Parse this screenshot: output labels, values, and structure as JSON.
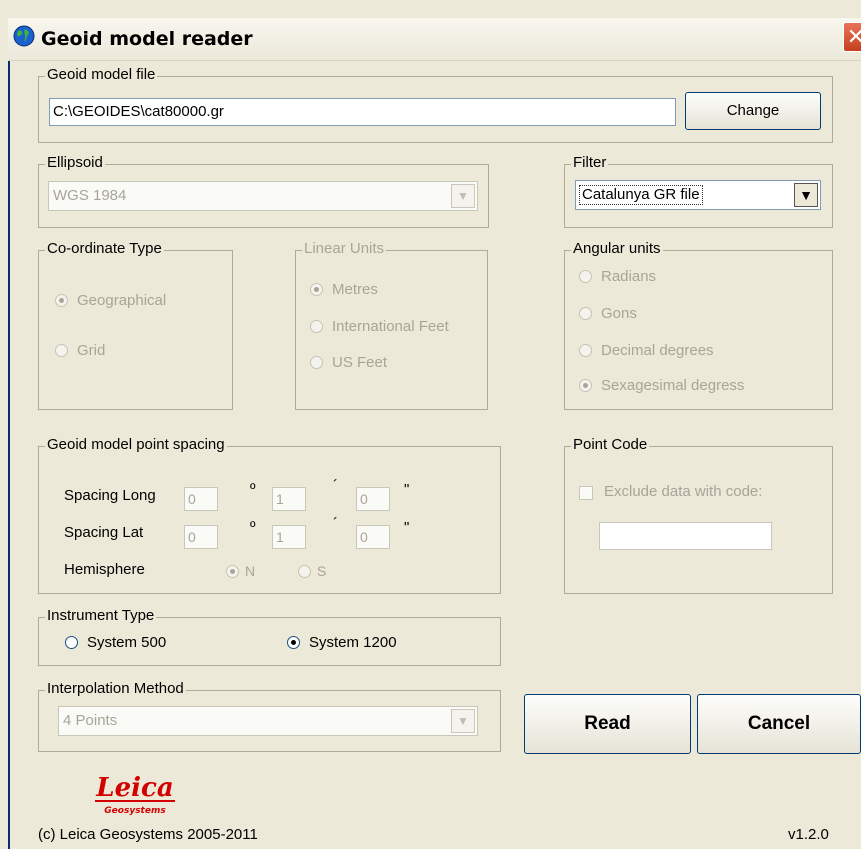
{
  "window": {
    "title": "Geoid model reader",
    "close_glyph": "✕",
    "icon": "globe-icon"
  },
  "model_file": {
    "legend": "Geoid model file",
    "path": "C:\\GEOIDES\\cat80000.gr",
    "change_label": "Change"
  },
  "ellipsoid": {
    "legend": "Ellipsoid",
    "value": "WGS 1984"
  },
  "filter": {
    "legend": "Filter",
    "value": "Catalunya GR file"
  },
  "coord_type": {
    "legend": "Co-ordinate Type",
    "options": [
      {
        "label": "Geographical",
        "selected": true
      },
      {
        "label": "Grid",
        "selected": false
      }
    ]
  },
  "linear_units": {
    "legend": "Linear Units",
    "options": [
      {
        "label": "Metres",
        "selected": true
      },
      {
        "label": "International Feet",
        "selected": false
      },
      {
        "label": "US Feet",
        "selected": false
      }
    ]
  },
  "angular_units": {
    "legend": "Angular units",
    "options": [
      {
        "label": "Radians",
        "selected": false
      },
      {
        "label": "Gons",
        "selected": false
      },
      {
        "label": "Decimal degrees",
        "selected": false
      },
      {
        "label": "Sexagesimal degress",
        "selected": true
      }
    ]
  },
  "spacing": {
    "legend": "Geoid model point spacing",
    "long_label": "Spacing  Long",
    "lat_label": "Spacing  Lat",
    "long_values": [
      "0",
      "1",
      "0"
    ],
    "lat_values": [
      "0",
      "1",
      "0"
    ],
    "deg_sym": "º",
    "min_sym": "´",
    "sec_sym": "\"",
    "hemisphere_label": "Hemisphere",
    "hemisphere_n": "N",
    "hemisphere_s": "S"
  },
  "point_code": {
    "legend": "Point Code",
    "checkbox_label": "Exclude data with code:",
    "code_value": ""
  },
  "instrument": {
    "legend": "Instrument Type",
    "options": [
      {
        "label": "System 500",
        "selected": false
      },
      {
        "label": "System 1200",
        "selected": true
      }
    ]
  },
  "interpolation": {
    "legend": "Interpolation Method",
    "value": "4 Points"
  },
  "actions": {
    "read_label": "Read",
    "cancel_label": "Cancel"
  },
  "logo": {
    "brand": "Leica",
    "sub": "Geosystems"
  },
  "footer": {
    "copyright": "(c) Leica Geosystems 2005-2011",
    "version": "v1.2.0"
  },
  "colors": {
    "disabled_text": "#a8a598",
    "face": "#ece9d8",
    "close_red": "#d2502f",
    "logo_red": "#d40000"
  }
}
